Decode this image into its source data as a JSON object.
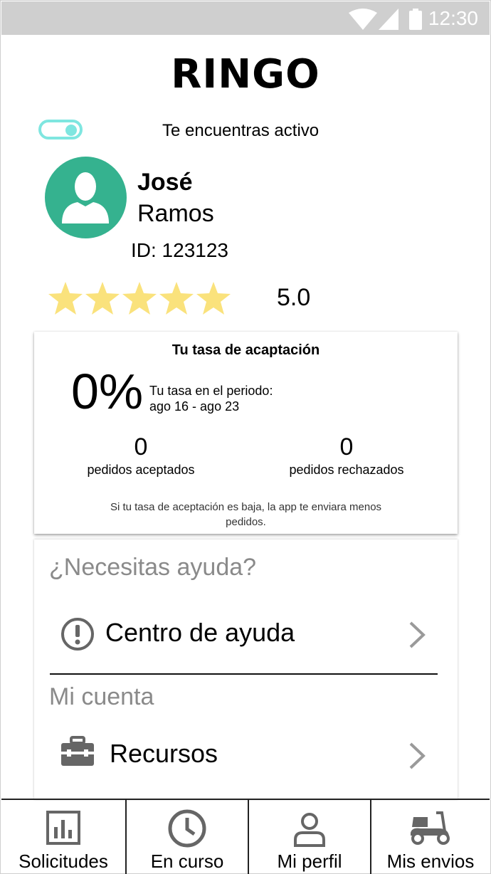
{
  "status_bar": {
    "time": "12:30",
    "icons": [
      "wifi-icon",
      "signal-icon",
      "battery-icon"
    ]
  },
  "app": {
    "logo": "RINGO"
  },
  "availability": {
    "toggle_on": true,
    "text": "Te encuentras activo",
    "toggle_color": "#7fe6e0"
  },
  "profile": {
    "first_name": "José",
    "last_name": "Ramos",
    "id": "ID: 123123",
    "avatar_color": "#35b28f",
    "stars": 5,
    "rating": "5.0",
    "star_color": "#fae27c"
  },
  "acceptance": {
    "title": "Tu tasa de acaptación",
    "rate": "0%",
    "period_label": "Tu tasa en el periodo:",
    "period_range": "ago 16 - ago 23",
    "accepted_count": "0",
    "accepted_label": "pedidos aceptados",
    "rejected_count": "0",
    "rejected_label": "pedidos rechazados",
    "note": "Si tu tasa de aceptación es baja, la app te enviara menos pedidos."
  },
  "help": {
    "heading": "¿Necesitas ayuda?",
    "items": [
      {
        "label": "Centro de ayuda",
        "icon": "alert-circle-icon"
      }
    ]
  },
  "account": {
    "heading": "Mi cuenta",
    "items": [
      {
        "label": "Recursos",
        "icon": "toolbox-icon"
      }
    ]
  },
  "tabs": [
    {
      "label": "Solicitudes",
      "icon": "bar-chart-icon"
    },
    {
      "label": "En curso",
      "icon": "clock-icon"
    },
    {
      "label": "Mi perfil",
      "icon": "person-icon"
    },
    {
      "label": "Mis envios",
      "icon": "scooter-icon"
    }
  ]
}
